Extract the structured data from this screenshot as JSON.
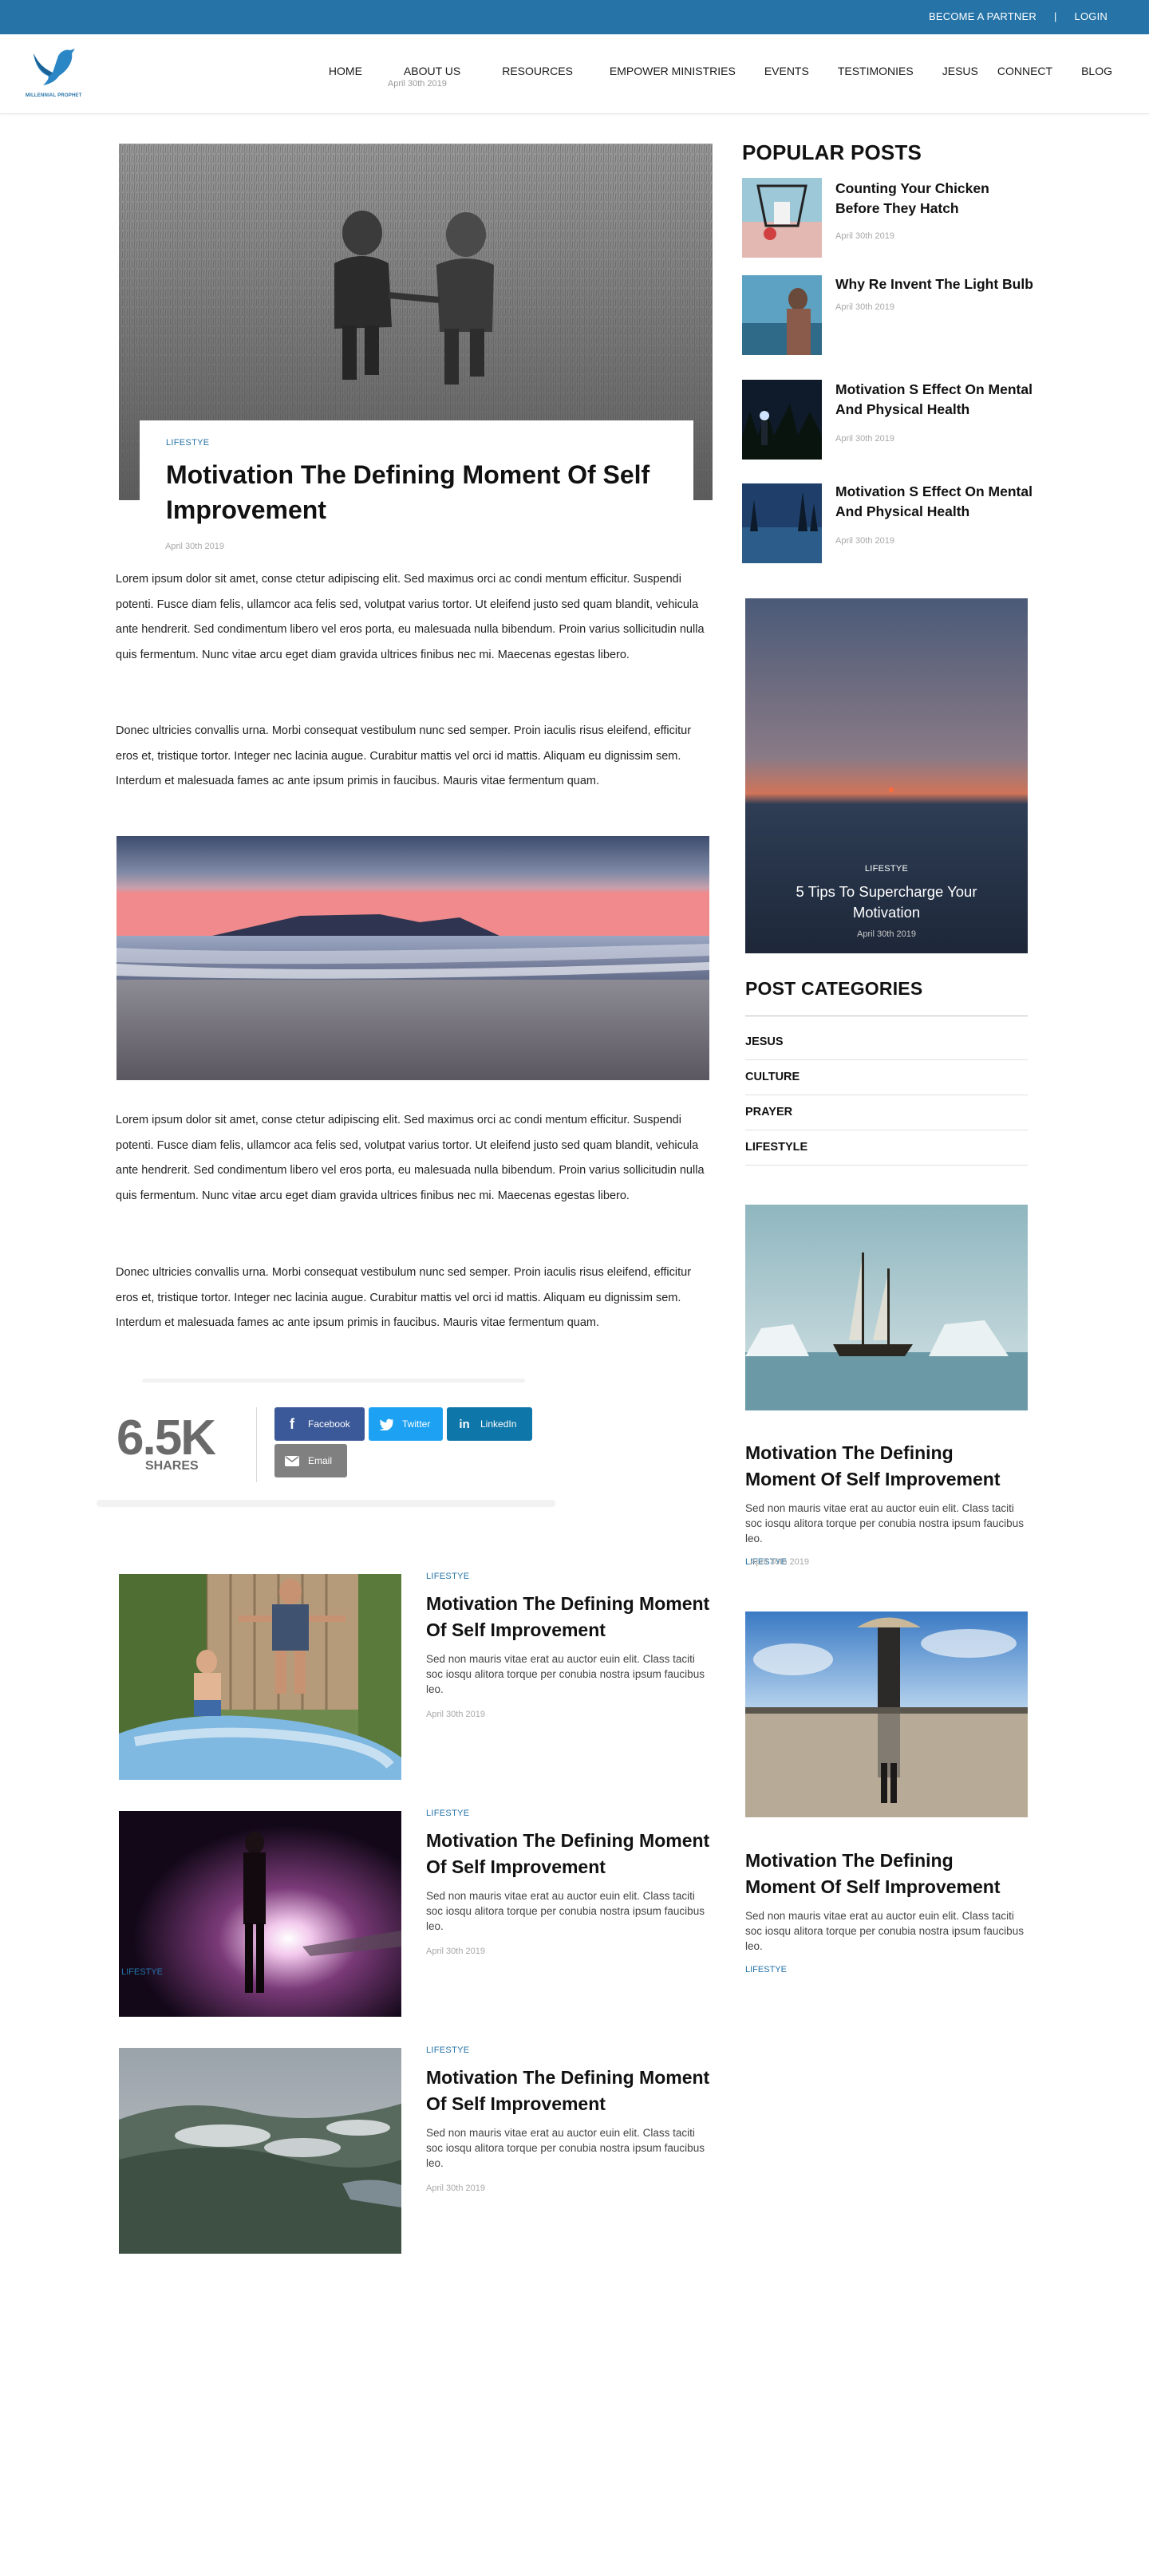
{
  "topbar": {
    "partner_label": "BECOME A PARTNER",
    "separator": "|",
    "login_label": "LOGIN"
  },
  "logo": {
    "text": "MILLENNIAL PROPHET",
    "icon": "dove-logo-icon"
  },
  "nav": {
    "items": [
      {
        "label": "HOME"
      },
      {
        "label": "ABOUT US"
      },
      {
        "label": "RESOURCES"
      },
      {
        "label": "EMPOWER MINISTRIES"
      },
      {
        "label": "EVENTS"
      },
      {
        "label": "TESTIMONIES"
      },
      {
        "label": "JESUS"
      },
      {
        "label": "CONNECT"
      },
      {
        "label": "BLOG"
      }
    ],
    "sub_date": "April 30th 2019"
  },
  "article": {
    "category": "LIFESTYE",
    "title": "Motivation The Defining Moment Of Self Improvement",
    "date": "April 30th 2019",
    "paragraphs": [
      "Lorem ipsum dolor sit amet, conse ctetur adipiscing elit. Sed maximus orci ac condi mentum efficitur. Suspendi potenti. Fusce diam felis, ullamcor aca felis sed, volutpat varius tortor. Ut eleifend justo sed quam blandit, vehicula ante hendrerit. Sed condimentum libero vel eros porta, eu malesuada nulla bibendum. Proin varius sollicitudin nulla quis fermentum. Nunc vitae arcu eget diam gravida ultrices finibus nec mi. Maecenas egestas libero.",
      "Donec ultricies convallis urna. Morbi consequat vestibulum nunc sed semper. Proin iaculis risus eleifend, efficitur eros et, tristique tortor. Integer nec lacinia augue. Curabitur mattis vel orci id mattis. Aliquam eu dignissim sem. Interdum et malesuada fames ac ante ipsum primis in faucibus. Mauris vitae fermentum quam.",
      "Lorem ipsum dolor sit amet, conse ctetur adipiscing elit. Sed maximus orci ac condi mentum efficitur. Suspendi potenti. Fusce diam felis, ullamcor aca felis sed, volutpat varius tortor. Ut eleifend justo sed quam blandit, vehicula ante hendrerit. Sed condimentum libero vel eros porta, eu malesuada nulla bibendum. Proin varius sollicitudin nulla quis fermentum. Nunc vitae arcu eget diam gravida ultrices finibus nec mi. Maecenas egestas libero.",
      "Donec ultricies convallis urna. Morbi consequat vestibulum nunc sed semper. Proin iaculis risus eleifend, efficitur eros et, tristique tortor. Integer nec lacinia augue. Curabitur mattis vel orci id mattis. Aliquam eu dignissim sem. Interdum et malesuada fames ac ante ipsum primis in faucibus. Mauris vitae fermentum quam."
    ]
  },
  "shares": {
    "count": "6.5K",
    "label": "SHARES",
    "buttons": [
      {
        "label": "Facebook",
        "icon": "facebook-icon",
        "color": "#3b5998"
      },
      {
        "label": "Twitter",
        "icon": "twitter-icon",
        "color": "#1da1f2"
      },
      {
        "label": "LinkedIn",
        "icon": "linkedin-icon",
        "color": "#0e76a8"
      },
      {
        "label": "Email",
        "icon": "email-icon",
        "color": "#808080"
      }
    ]
  },
  "related": [
    {
      "category": "LIFESTYE",
      "title": "Motivation The Defining Moment Of Self Improvement",
      "desc": "Sed non mauris vitae erat au auctor euin elit. Class taciti soc iosqu alitora torque per conubia nostra ipsum faucibus leo.",
      "date": "April 30th 2019"
    },
    {
      "category": "LIFESTYE",
      "title": "Motivation The Defining Moment Of Self Improvement",
      "desc": "Sed non mauris vitae erat au auctor euin elit. Class taciti soc iosqu alitora torque per conubia nostra ipsum faucibus leo.",
      "date": "April 30th 2019",
      "overlay": "LIFESTYE"
    },
    {
      "category": "LIFESTYE",
      "title": "Motivation The Defining Moment Of Self Improvement",
      "desc": "Sed non mauris vitae erat au auctor euin elit. Class taciti soc iosqu alitora torque per conubia nostra ipsum faucibus leo.",
      "date": "April 30th 2019"
    }
  ],
  "sidebar": {
    "popular_heading": "POPULAR POSTS",
    "popular": [
      {
        "title": "Counting Your Chicken Before They Hatch",
        "date": "April 30th 2019"
      },
      {
        "title": "Why Re Invent The Light Bulb",
        "date": "April 30th 2019"
      },
      {
        "title": "Motivation S Effect On Mental And Physical Health",
        "date": "April 30th 2019"
      },
      {
        "title": "Motivation S Effect On Mental And Physical Health",
        "date": "April 30th 2019"
      }
    ],
    "feature": {
      "category": "LIFESTYE",
      "title": "5 Tips To Supercharge Your Motivation",
      "date": "April 30th 2019"
    },
    "categories_heading": "POST CATEGORIES",
    "categories": [
      "JESUS",
      "CULTURE",
      "PRAYER",
      "LIFESTYLE"
    ],
    "cards": [
      {
        "title": "Motivation The Defining Moment Of Self Improvement",
        "desc": "Sed non mauris vitae erat au auctor euin elit. Class taciti soc iosqu alitora torque per conubia nostra ipsum faucibus leo.",
        "category": "LIFESTYE",
        "date": "April 30th 2019"
      },
      {
        "title": "Motivation The Defining Moment Of Self Improvement",
        "desc": "Sed non mauris vitae erat au auctor euin elit. Class taciti soc iosqu alitora torque per conubia nostra ipsum faucibus leo.",
        "category": "LIFESTYE"
      }
    ]
  },
  "colors": {
    "brand": "#2573a7",
    "text": "#111111",
    "muted": "#a8a8a8"
  }
}
